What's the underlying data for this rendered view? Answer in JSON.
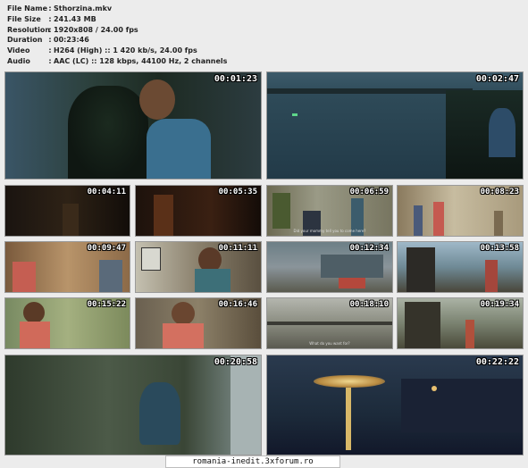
{
  "info": [
    {
      "key": "File Name",
      "value": "Sthorzina.mkv"
    },
    {
      "key": "File Size",
      "value": "241.43 MB"
    },
    {
      "key": "Resolution",
      "value": "1920x808 / 24.00 fps"
    },
    {
      "key": "Duration",
      "value": "00:23:46"
    },
    {
      "key": "Video",
      "value": "H264 (High) :: 1 420 kb/s, 24.00 fps"
    },
    {
      "key": "Audio",
      "value": "AAC (LC) :: 128 kbps, 44100 Hz, 2 channels"
    }
  ],
  "separator": ":",
  "timestamps": [
    "00:01:23",
    "00:02:47",
    "00:04:11",
    "00:05:35",
    "00:06:59",
    "00:08:23",
    "00:09:47",
    "00:11:11",
    "00:12:34",
    "00:13:58",
    "00:15:22",
    "00:16:46",
    "00:18:10",
    "00:19:34",
    "00:20:58",
    "00:22:22"
  ],
  "subtitles": {
    "t5": "Did your mommy tell you to come here?",
    "t13": "What do you want for?"
  },
  "footer": "romania-inedit.3xforum.ro"
}
